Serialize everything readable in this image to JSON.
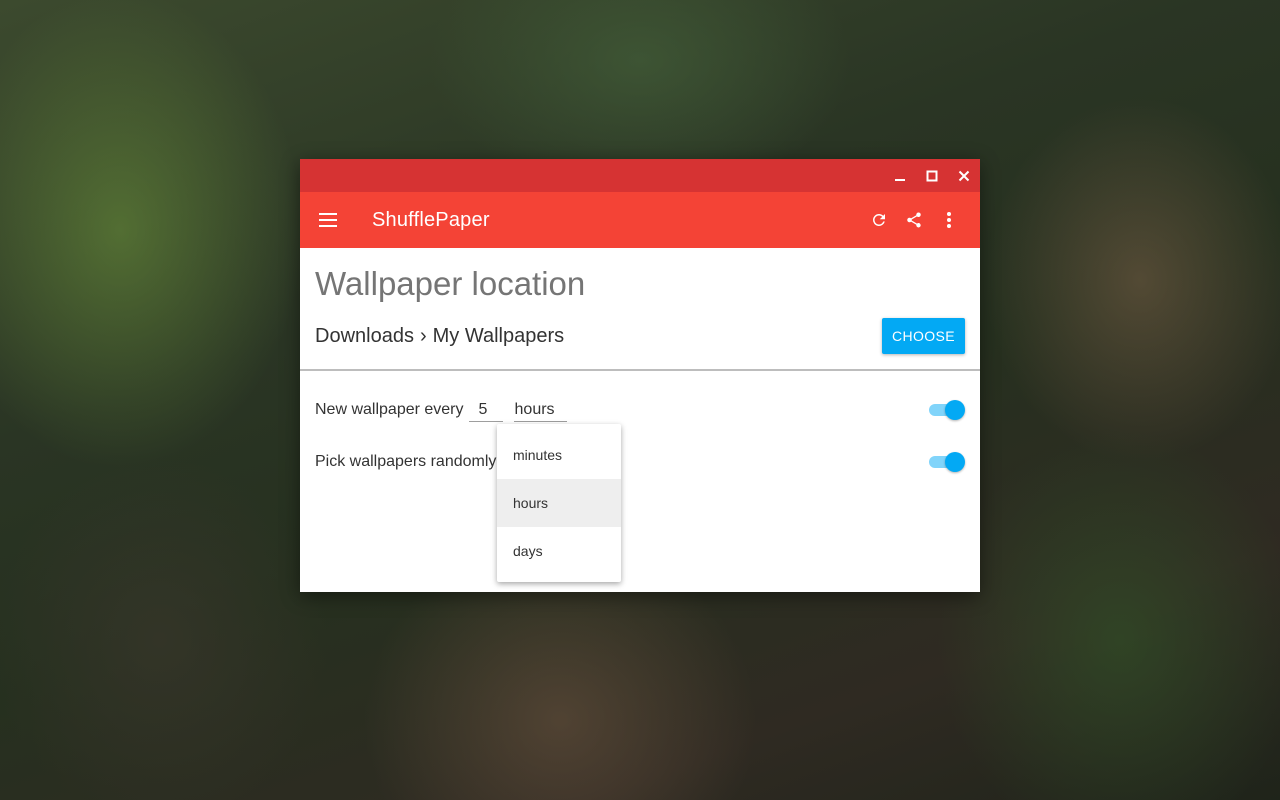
{
  "window": {
    "title": "ShufflePaper",
    "controls": [
      "minimize-icon",
      "maximize-icon",
      "close-icon"
    ]
  },
  "toolbar": {
    "menu_icon": "menu-icon",
    "actions": [
      "refresh-icon",
      "share-icon",
      "more-vert-icon"
    ]
  },
  "location": {
    "heading": "Wallpaper location",
    "path": [
      "Downloads",
      "My Wallpapers"
    ],
    "separator": "›",
    "choose_label": "CHOOSE"
  },
  "settings": {
    "interval_label": "New wallpaper every",
    "interval_value": "5",
    "interval_unit": "hours",
    "interval_enabled": true,
    "random_label": "Pick wallpapers randomly",
    "random_enabled": true
  },
  "dropdown": {
    "options": [
      "minutes",
      "hours",
      "days"
    ],
    "selected": "hours"
  },
  "colors": {
    "title_bar": "#d63333",
    "app_bar": "#f44336",
    "accent": "#03a9f4",
    "toggle_track": "#81d4fa"
  }
}
